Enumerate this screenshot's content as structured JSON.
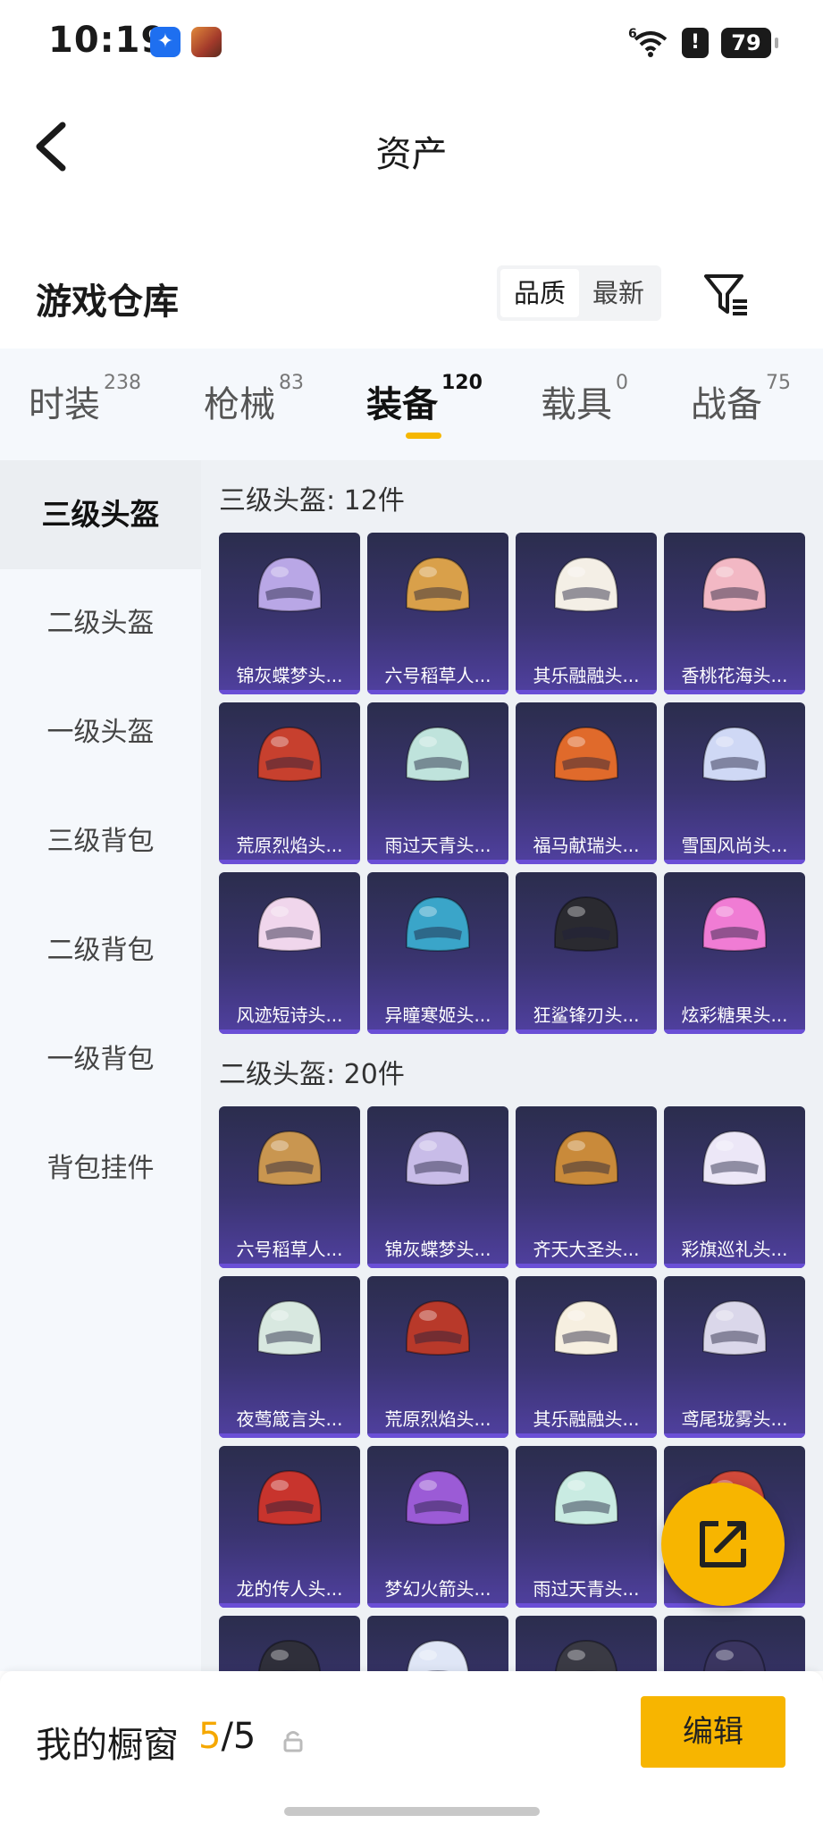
{
  "status_bar": {
    "time": "10:19",
    "battery": "79",
    "network": "6"
  },
  "header": {
    "title": "资产"
  },
  "warehouse": {
    "title": "游戏仓库",
    "sort_options": [
      "品质",
      "最新"
    ]
  },
  "categories": [
    {
      "label": "时装",
      "count": "238"
    },
    {
      "label": "枪械",
      "count": "83"
    },
    {
      "label": "装备",
      "count": "120"
    },
    {
      "label": "载具",
      "count": "0"
    },
    {
      "label": "战备",
      "count": "75"
    }
  ],
  "sidebar": {
    "items": [
      "三级头盔",
      "二级头盔",
      "一级头盔",
      "三级背包",
      "二级背包",
      "一级背包",
      "背包挂件"
    ]
  },
  "sections": [
    {
      "title": "三级头盔: 12件",
      "items": [
        {
          "name": "锦灰蝶梦头...",
          "color": "#b9a7e6"
        },
        {
          "name": "六号稻草人...",
          "color": "#d9a04a"
        },
        {
          "name": "其乐融融头...",
          "color": "#f4efe6"
        },
        {
          "name": "香桃花海头...",
          "color": "#f2b8c4"
        },
        {
          "name": "荒原烈焰头...",
          "color": "#c7402e"
        },
        {
          "name": "雨过天青头...",
          "color": "#bfe3dc"
        },
        {
          "name": "福马献瑞头...",
          "color": "#e06a2b"
        },
        {
          "name": "雪国风尚头...",
          "color": "#cfd8f5"
        },
        {
          "name": "风迹短诗头...",
          "color": "#f0d6ec"
        },
        {
          "name": "异瞳寒姬头...",
          "color": "#3aa5c9"
        },
        {
          "name": "狂鲨锋刃头...",
          "color": "#2a2a30"
        },
        {
          "name": "炫彩糖果头...",
          "color": "#f07cd4"
        }
      ]
    },
    {
      "title": "二级头盔: 20件",
      "items": [
        {
          "name": "六号稻草人...",
          "color": "#c99650"
        },
        {
          "name": "锦灰蝶梦头...",
          "color": "#c8bce8"
        },
        {
          "name": "齐天大圣头...",
          "color": "#c98a3a"
        },
        {
          "name": "彩旗巡礼头...",
          "color": "#ece7f7"
        },
        {
          "name": "夜莺箴言头...",
          "color": "#d8e8e0"
        },
        {
          "name": "荒原烈焰头...",
          "color": "#b8392a"
        },
        {
          "name": "其乐融融头...",
          "color": "#f6efe0"
        },
        {
          "name": "鸢尾珑雾头...",
          "color": "#dad7ea"
        },
        {
          "name": "龙的传人头...",
          "color": "#c8342d"
        },
        {
          "name": "梦幻火箭头...",
          "color": "#9b5bd6"
        },
        {
          "name": "雨过天青头...",
          "color": "#c9ebe2"
        },
        {
          "name": "",
          "color": "#d24a3a"
        },
        {
          "name": "",
          "color": "#2f2f3a"
        },
        {
          "name": "",
          "color": "#dfe6f6"
        },
        {
          "name": "",
          "color": "#3a3a44"
        },
        {
          "name": "",
          "color": "#3a3560"
        }
      ]
    }
  ],
  "showcase": {
    "label": "我的橱窗",
    "current": "5",
    "total": "/5"
  },
  "edit_label": "编辑"
}
